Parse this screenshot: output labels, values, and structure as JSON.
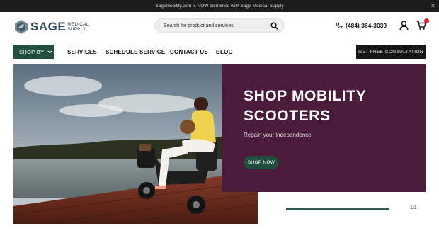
{
  "announcement": {
    "text": "Sagemobility.com is NOW combined with Sage Medical Supply",
    "close_label": "×"
  },
  "header": {
    "logo": {
      "word": "SAGE",
      "line1": "Medical",
      "line2": "Supply"
    },
    "search": {
      "placeholder": "Search for product and services",
      "value": ""
    },
    "phone": "(484) 364-3039",
    "cart_count_badge": "red"
  },
  "nav": {
    "shop_by": "SHOP BY",
    "links": [
      "SERVICES",
      "SCHEDULE SERVICE",
      "CONTACT US",
      "BLOG"
    ],
    "consult": "GET FREE CONSULTATION"
  },
  "hero": {
    "title": "SHOP MOBILITY SCOOTERS",
    "subtitle": "Regain your independence",
    "cta": "SHOP NOW",
    "slide_counter": "1/1",
    "slide_progress": 1.0
  },
  "colors": {
    "brand_green": "#22503f",
    "panel_purple": "#4a1b3a",
    "logo_blue": "#2f4a5c",
    "badge_red": "#d21f2b"
  }
}
